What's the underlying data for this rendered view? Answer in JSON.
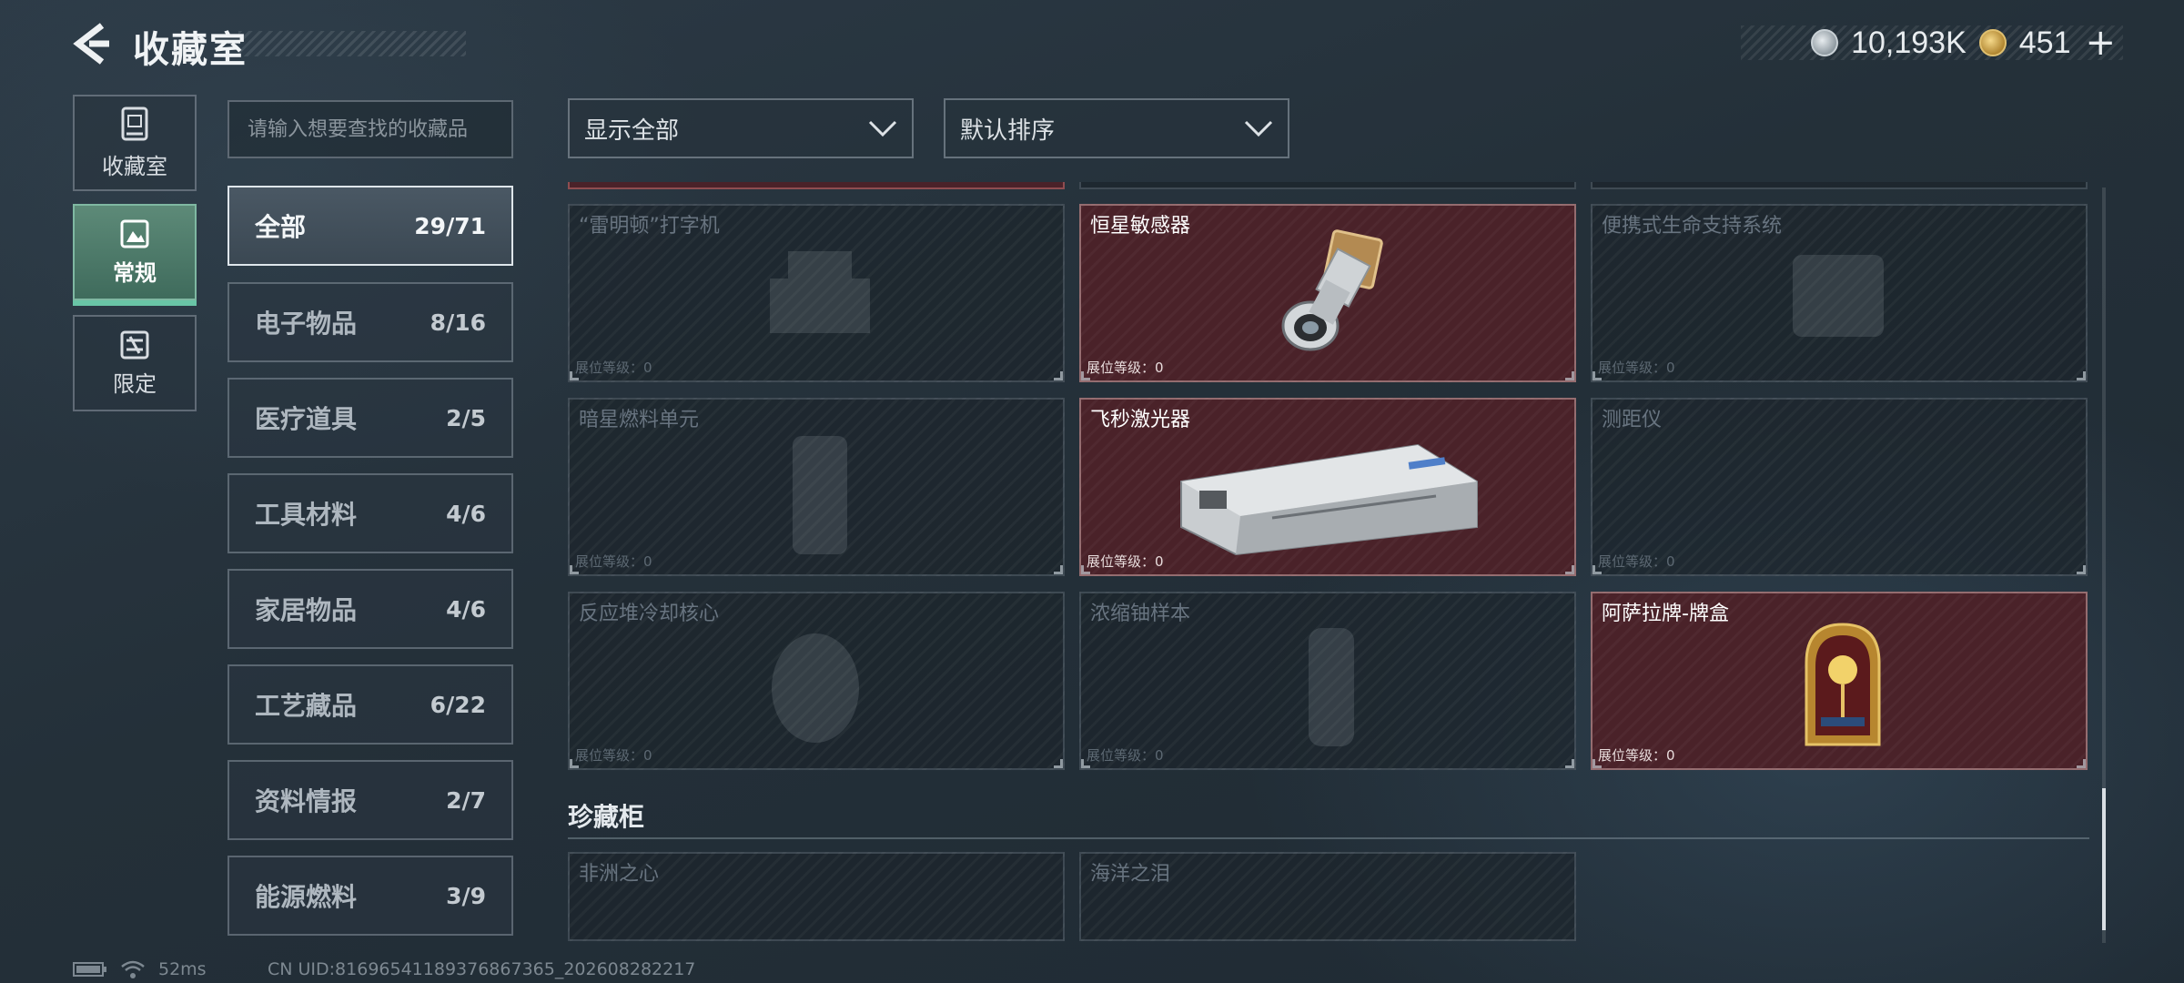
{
  "header": {
    "title": "收藏室",
    "currency_primary": "10,193K",
    "currency_secondary": "451",
    "plus": "+"
  },
  "left_nav": {
    "items": [
      {
        "label": "收藏室",
        "icon": "vault-icon",
        "active": false
      },
      {
        "label": "常规",
        "icon": "image-frame-icon",
        "active": true
      },
      {
        "label": "限定",
        "icon": "limited-icon",
        "active": false
      }
    ]
  },
  "search": {
    "placeholder": "请输入想要查找的收藏品"
  },
  "categories": [
    {
      "name": "全部",
      "count": "29/71",
      "active": true
    },
    {
      "name": "电子物品",
      "count": "8/16"
    },
    {
      "name": "医疗道具",
      "count": "2/5"
    },
    {
      "name": "工具材料",
      "count": "4/6"
    },
    {
      "name": "家居物品",
      "count": "4/6"
    },
    {
      "name": "工艺藏品",
      "count": "6/22"
    },
    {
      "name": "资料情报",
      "count": "2/7"
    },
    {
      "name": "能源燃料",
      "count": "3/9"
    }
  ],
  "filters": {
    "show": "显示全部",
    "sort": "默认排序"
  },
  "level_label": "展位等级：0",
  "items": [
    {
      "name": "“雷明顿”打字机",
      "owned": false,
      "icon": "typewriter-icon"
    },
    {
      "name": "恒星敏感器",
      "owned": true,
      "icon": "star-sensor-icon"
    },
    {
      "name": "便携式生命支持系统",
      "owned": false,
      "icon": "life-support-icon"
    },
    {
      "name": "暗星燃料单元",
      "owned": false,
      "icon": "fuel-cell-icon"
    },
    {
      "name": "飞秒激光器",
      "owned": true,
      "icon": "laser-icon"
    },
    {
      "name": "测距仪",
      "owned": false,
      "icon": "rangefinder-icon"
    },
    {
      "name": "反应堆冷却核心",
      "owned": false,
      "icon": "reactor-core-icon"
    },
    {
      "name": "浓缩铀样本",
      "owned": false,
      "icon": "uranium-sample-icon"
    },
    {
      "name": "阿萨拉牌-牌盒",
      "owned": true,
      "icon": "card-box-icon"
    }
  ],
  "treasure": {
    "title": "珍藏柜",
    "items": [
      {
        "name": "非洲之心",
        "owned": false,
        "icon": "gem-icon"
      },
      {
        "name": "海洋之泪",
        "owned": false,
        "icon": "gem-icon"
      }
    ]
  },
  "status": {
    "latency": "52ms",
    "uid": "CN UID:81696541189376867365_202608282217"
  },
  "colors": {
    "owned_bg": "#4a2229",
    "active_nav": "#4f7d6c",
    "accent_underline": "#69c5a6"
  }
}
